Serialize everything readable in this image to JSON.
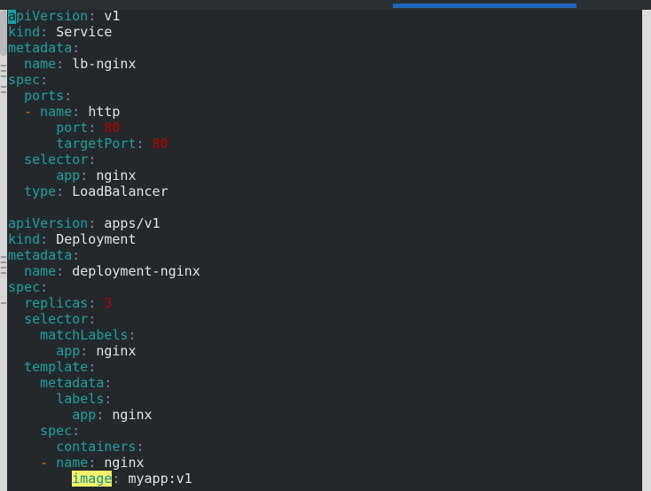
{
  "window": {
    "background_color": "#24282b",
    "accent_color": "#2266bb"
  },
  "topbar": {
    "progress_label": "",
    "progress_color": "#2266bb"
  },
  "scrollbars": {
    "left_label": "",
    "right_label": ""
  },
  "editor": {
    "language": "yaml",
    "cursor_char": "a",
    "highlight_word": "image",
    "highlight_bg": "#f6f36a",
    "key_color": "#21a0a0",
    "value_color": "#dfe4e7",
    "number_color": "#bb0000",
    "dash_color": "#cc7a22",
    "lines": [
      {
        "indent": 0,
        "key": "apiVersion",
        "value": "v1",
        "kind": "kv",
        "cursor": true
      },
      {
        "indent": 0,
        "key": "kind",
        "value": "Service",
        "kind": "kv"
      },
      {
        "indent": 0,
        "key": "metadata",
        "value": "",
        "kind": "map"
      },
      {
        "indent": 2,
        "key": "name",
        "value": "lb-nginx",
        "kind": "kv"
      },
      {
        "indent": 0,
        "key": "spec",
        "value": "",
        "kind": "map"
      },
      {
        "indent": 2,
        "key": "ports",
        "value": "",
        "kind": "map"
      },
      {
        "indent": 4,
        "key": "name",
        "value": "http",
        "kind": "item"
      },
      {
        "indent": 6,
        "key": "port",
        "value": "80",
        "kind": "num"
      },
      {
        "indent": 6,
        "key": "targetPort",
        "value": "80",
        "kind": "num"
      },
      {
        "indent": 2,
        "key": "selector",
        "value": "",
        "kind": "map"
      },
      {
        "indent": 6,
        "key": "app",
        "value": "nginx",
        "kind": "kv"
      },
      {
        "indent": 2,
        "key": "type",
        "value": "LoadBalancer",
        "kind": "kv"
      },
      {
        "indent": 0,
        "key": "",
        "value": "",
        "kind": "blank"
      },
      {
        "indent": 0,
        "key": "apiVersion",
        "value": "apps/v1",
        "kind": "kv"
      },
      {
        "indent": 0,
        "key": "kind",
        "value": "Deployment",
        "kind": "kv"
      },
      {
        "indent": 0,
        "key": "metadata",
        "value": "",
        "kind": "map"
      },
      {
        "indent": 2,
        "key": "name",
        "value": "deployment-nginx",
        "kind": "kv"
      },
      {
        "indent": 0,
        "key": "spec",
        "value": "",
        "kind": "map"
      },
      {
        "indent": 2,
        "key": "replicas",
        "value": "3",
        "kind": "num"
      },
      {
        "indent": 2,
        "key": "selector",
        "value": "",
        "kind": "map"
      },
      {
        "indent": 4,
        "key": "matchLabels",
        "value": "",
        "kind": "map"
      },
      {
        "indent": 6,
        "key": "app",
        "value": "nginx",
        "kind": "kv"
      },
      {
        "indent": 2,
        "key": "template",
        "value": "",
        "kind": "map"
      },
      {
        "indent": 4,
        "key": "metadata",
        "value": "",
        "kind": "map"
      },
      {
        "indent": 6,
        "key": "labels",
        "value": "",
        "kind": "map"
      },
      {
        "indent": 8,
        "key": "app",
        "value": "nginx",
        "kind": "kv"
      },
      {
        "indent": 4,
        "key": "spec",
        "value": "",
        "kind": "map"
      },
      {
        "indent": 6,
        "key": "containers",
        "value": "",
        "kind": "map"
      },
      {
        "indent": 6,
        "key": "name",
        "value": "nginx",
        "kind": "item"
      },
      {
        "indent": 8,
        "key": "image",
        "value": "myapp:v1",
        "kind": "kv",
        "highlight": true
      }
    ]
  }
}
